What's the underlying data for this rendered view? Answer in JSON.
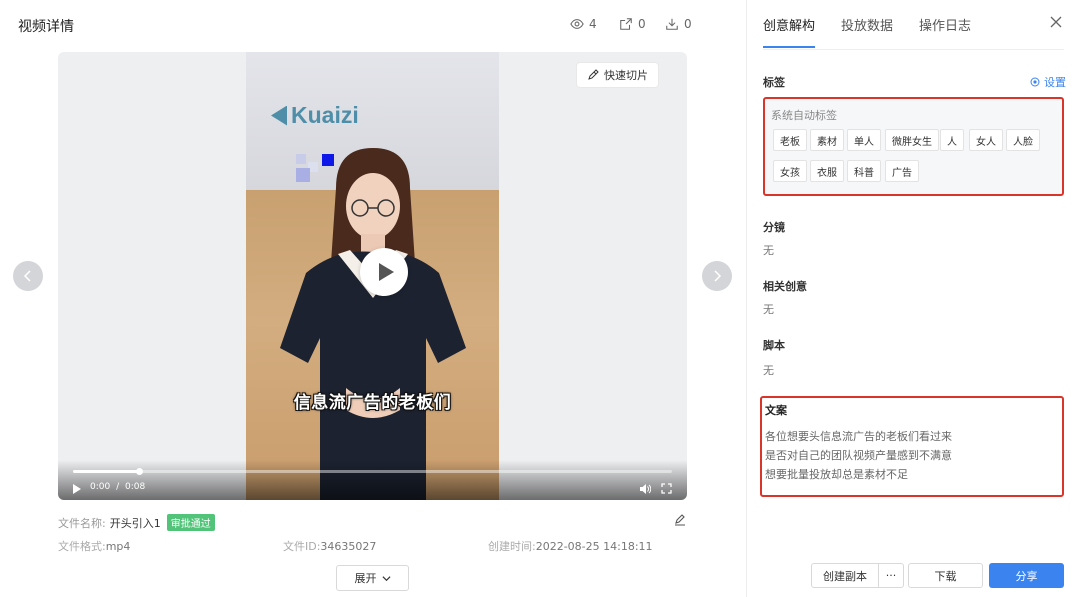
{
  "header": {
    "title": "视频详情",
    "views": "4",
    "shares": "0",
    "downloads": "0"
  },
  "video": {
    "logo_text": "Kuaizi",
    "subtitle": "信息流广告的老板们",
    "quick_cut_label": "快速切片",
    "current_time": "0:00",
    "separator": "/",
    "duration": "0:08",
    "progress_fraction": 0.11
  },
  "file": {
    "name_label": "文件名称:",
    "name_value": "开头引入1",
    "status_badge": "审批通过",
    "format_label": "文件格式:",
    "format_value": "mp4",
    "id_label": "文件ID:",
    "id_value": "34635027",
    "created_label": "创建时间:",
    "created_value": "2022-08-25 14:18:11",
    "expand_label": "展开"
  },
  "panel": {
    "tabs": [
      "创意解构",
      "投放数据",
      "操作日志"
    ],
    "tags_title": "标签",
    "settings_label": "设置",
    "auto_tags_title": "系统自动标签",
    "tags": [
      "老板",
      "素材",
      "单人",
      "微胖女生",
      "人",
      "女人",
      "人脸",
      "女孩",
      "衣服",
      "科普",
      "广告"
    ],
    "storyboard_title": "分镜",
    "storyboard_value": "无",
    "related_title": "相关创意",
    "related_value": "无",
    "script_title": "脚本",
    "script_value": "无",
    "copy_title": "文案",
    "copy_lines": [
      "各位想要头信息流广告的老板们看过来",
      "是否对自己的团队视频产量感到不满意",
      "想要批量投放却总是素材不足"
    ]
  },
  "footer": {
    "create_copy": "创建副本",
    "more": "···",
    "download": "下载",
    "share": "分享"
  },
  "colors": {
    "accent": "#3b84f0",
    "highlight_border": "#d9352b",
    "badge": "#52c47a"
  }
}
